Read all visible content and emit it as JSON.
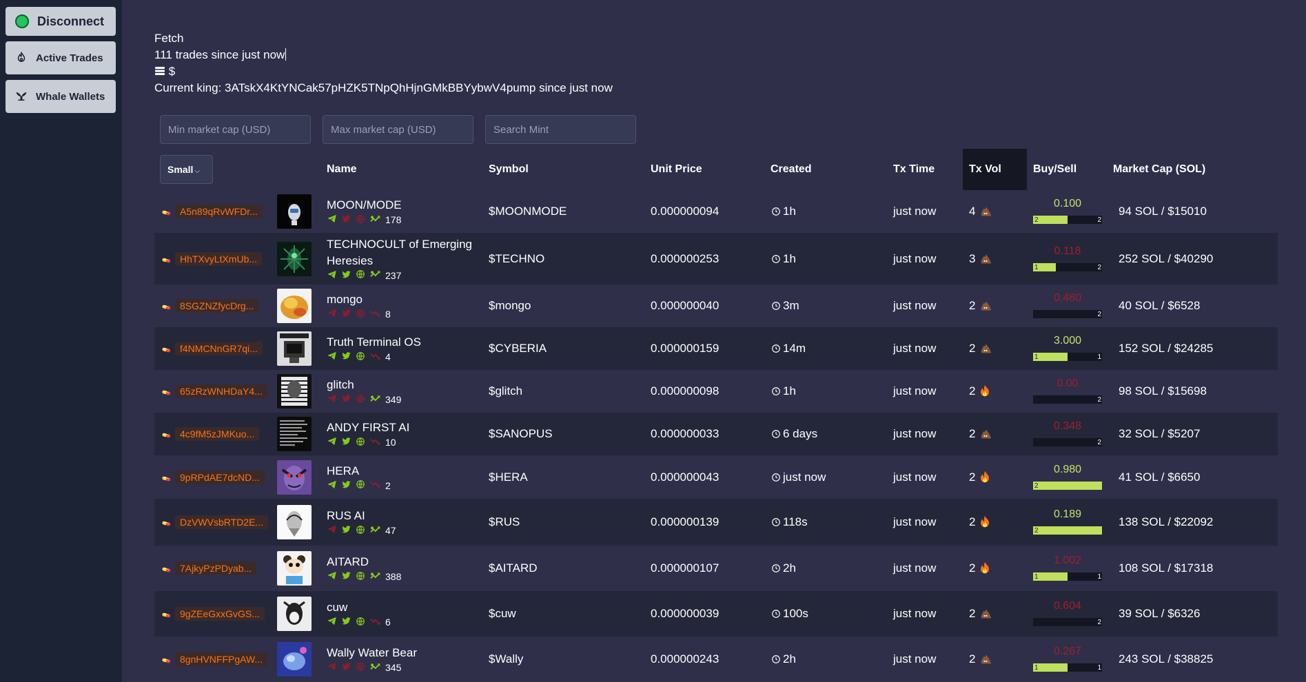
{
  "sidebar": {
    "disconnect_label": "Disconnect",
    "active_trades_label": "Active Trades",
    "whale_wallets_label": "Whale Wallets"
  },
  "info": {
    "fetch_label": "Fetch",
    "trades_text": "111 trades since just now",
    "balance_text": "$",
    "king_text": "Current king: 3ATskX4KtYNCak57pHZK5TNpQhHjnGMkBBYybwV4pump since just now"
  },
  "filters": {
    "min_placeholder": "Min market cap (USD)",
    "max_placeholder": "Max market cap (USD)",
    "search_placeholder": "Search Mint"
  },
  "table": {
    "size_select": "Small",
    "headers": {
      "name": "Name",
      "symbol": "Symbol",
      "unit_price": "Unit Price",
      "created": "Created",
      "tx_time": "Tx Time",
      "tx_vol": "Tx Vol",
      "buy_sell": "Buy/Sell",
      "market_cap": "Market Cap (SOL)"
    },
    "rows": [
      {
        "mint": "A5n89qRvWFDr...",
        "name1": "MOON/MODE",
        "name2": "",
        "tg": true,
        "tw": false,
        "web": false,
        "ptrend": true,
        "count": "178",
        "symbol": "$MOONMODE",
        "price": "0.000000094",
        "created": "1h",
        "txtime": "just now",
        "txvol": "4",
        "volicon": "poop",
        "ratio": "0.100",
        "ratio_good": true,
        "fill": 0.5,
        "buys": "2",
        "sells": "2",
        "mcap": "94 SOL / $15010",
        "thumb": "moon"
      },
      {
        "mint": "HhTXvyLtXmUb...",
        "name1": "TECHNOCULT of Emerging",
        "name2": "Heresies",
        "tg": true,
        "tw": true,
        "web": true,
        "ptrend": true,
        "count": "237",
        "symbol": "$TECHNO",
        "price": "0.000000253",
        "created": "1h",
        "txtime": "just now",
        "txvol": "3",
        "volicon": "poop",
        "ratio": "0.118",
        "ratio_good": false,
        "fill": 0.33,
        "buys": "1",
        "sells": "2",
        "mcap": "252 SOL / $40290",
        "thumb": "techno"
      },
      {
        "mint": "8SGZNZfycDrg...",
        "name1": "mongo",
        "name2": "",
        "tg": false,
        "tw": false,
        "web": false,
        "ptrend": false,
        "count": "8",
        "symbol": "$mongo",
        "price": "0.000000040",
        "created": "3m",
        "txtime": "just now",
        "txvol": "2",
        "volicon": "poop",
        "ratio": "0.480",
        "ratio_good": false,
        "fill": 0,
        "buys": "",
        "sells": "2",
        "mcap": "40 SOL / $6528",
        "thumb": "mango"
      },
      {
        "mint": "f4NMCNnGR7qi...",
        "name1": "Truth Terminal OS",
        "name2": "",
        "tg": true,
        "tw": true,
        "web": true,
        "ptrend": false,
        "count": "4",
        "symbol": "$CYBERIA",
        "price": "0.000000159",
        "created": "14m",
        "txtime": "just now",
        "txvol": "2",
        "volicon": "poop",
        "ratio": "3.000",
        "ratio_good": true,
        "fill": 0.5,
        "buys": "1",
        "sells": "1",
        "mcap": "152 SOL / $24285",
        "thumb": "truth"
      },
      {
        "mint": "65zRzWNHDaY4...",
        "name1": "glitch",
        "name2": "",
        "tg": false,
        "tw": false,
        "web": false,
        "ptrend": true,
        "count": "349",
        "symbol": "$glitch",
        "price": "0.000000098",
        "created": "1h",
        "txtime": "just now",
        "txvol": "2",
        "volicon": "fire",
        "ratio": "0.00",
        "ratio_good": false,
        "fill": 0,
        "buys": "",
        "sells": "2",
        "mcap": "98 SOL / $15698",
        "thumb": "glitch"
      },
      {
        "mint": "4c9fM5zJMKuo...",
        "name1": "ANDY FIRST AI",
        "name2": "",
        "tg": true,
        "tw": true,
        "web": true,
        "ptrend": false,
        "count": "10",
        "symbol": "$SANOPUS",
        "price": "0.000000033",
        "created": "6 days",
        "txtime": "just now",
        "txvol": "2",
        "volicon": "poop",
        "ratio": "0.348",
        "ratio_good": false,
        "fill": 0,
        "buys": "",
        "sells": "2",
        "mcap": "32 SOL / $5207",
        "thumb": "andy"
      },
      {
        "mint": "9pRPdAE7dcND...",
        "name1": "HERA",
        "name2": "",
        "tg": true,
        "tw": true,
        "web": true,
        "ptrend": false,
        "count": "2",
        "symbol": "$HERA",
        "price": "0.000000043",
        "created": "just now",
        "txtime": "just now",
        "txvol": "2",
        "volicon": "fire",
        "ratio": "0.980",
        "ratio_good": true,
        "fill": 1,
        "buys": "2",
        "sells": "",
        "mcap": "41 SOL / $6650",
        "thumb": "hera"
      },
      {
        "mint": "DzVWVsbRTD2E...",
        "name1": "RUS AI",
        "name2": "",
        "tg": false,
        "tw": true,
        "web": true,
        "ptrend": true,
        "count": "47",
        "symbol": "$RUS",
        "price": "0.000000139",
        "created": "118s",
        "txtime": "just now",
        "txvol": "2",
        "volicon": "fire",
        "ratio": "0.189",
        "ratio_good": true,
        "fill": 1,
        "buys": "2",
        "sells": "",
        "mcap": "138 SOL / $22092",
        "thumb": "rus"
      },
      {
        "mint": "7AjkyPzPDyab...",
        "name1": "AITARD",
        "name2": "",
        "tg": true,
        "tw": true,
        "web": true,
        "ptrend": true,
        "count": "388",
        "symbol": "$AITARD",
        "price": "0.000000107",
        "created": "2h",
        "txtime": "just now",
        "txvol": "2",
        "volicon": "fire",
        "ratio": "1.002",
        "ratio_good": false,
        "fill": 0.5,
        "buys": "1",
        "sells": "1",
        "mcap": "108 SOL / $17318",
        "thumb": "aitard"
      },
      {
        "mint": "9gZEeGxxGvGS...",
        "name1": "cuw",
        "name2": "",
        "tg": true,
        "tw": true,
        "web": true,
        "ptrend": false,
        "count": "6",
        "symbol": "$cuw",
        "price": "0.000000039",
        "created": "100s",
        "txtime": "just now",
        "txvol": "2",
        "volicon": "poop",
        "ratio": "0.604",
        "ratio_good": false,
        "fill": 0,
        "buys": "",
        "sells": "2",
        "mcap": "39 SOL / $6326",
        "thumb": "cuw"
      },
      {
        "mint": "8gnHVNFFPgAW...",
        "name1": "Wally Water Bear",
        "name2": "",
        "tg": false,
        "tw": false,
        "web": false,
        "ptrend": true,
        "count": "345",
        "symbol": "$Wally",
        "price": "0.000000243",
        "created": "2h",
        "txtime": "just now",
        "txvol": "2",
        "volicon": "poop",
        "ratio": "0.267",
        "ratio_good": false,
        "fill": 0.5,
        "buys": "1",
        "sells": "1",
        "mcap": "243 SOL / $38825",
        "thumb": "wally"
      }
    ]
  },
  "colors": {
    "accent_green": "#bfe05d",
    "mint_orange": "#f97316",
    "bad_red": "#9f1f2b",
    "bg": "#2f2f4a",
    "sidebar": "#1c2335"
  }
}
